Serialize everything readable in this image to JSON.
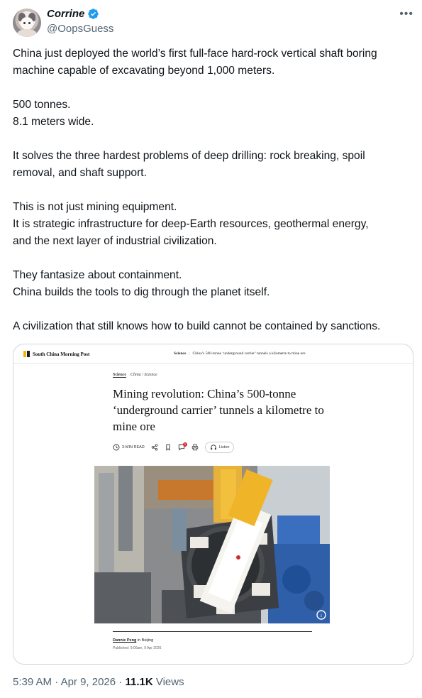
{
  "author": {
    "name": "Corrine",
    "handle": "@OopsGuess"
  },
  "tweet": {
    "paragraphs": [
      [
        "China just deployed the world’s first full-face hard-rock vertical shaft boring",
        "machine capable of excavating beyond 1,000 meters."
      ],
      [
        "500 tonnes.",
        "8.1 meters wide."
      ],
      [
        "It solves the three hardest problems of deep drilling: rock breaking, spoil",
        "removal, and shaft support."
      ],
      [
        "This is not just mining equipment.",
        "It is strategic infrastructure for deep-Earth resources, geothermal energy,",
        "and the next layer of industrial civilization."
      ],
      [
        "They fantasize about containment.",
        "China builds the tools to dig through the planet itself."
      ],
      [
        "A civilization that still knows how to build cannot be contained by sanctions."
      ]
    ]
  },
  "card": {
    "publication": "South China Morning Post",
    "crumb_section": "Science",
    "crumb_title": "China’s 500-tonne ‘underground carrier’ tunnels a kilometre to mine ore",
    "tag_main": "Science",
    "tag_sub": "China / Science",
    "headline": "Mining revolution: China’s 500-tonne ‘underground carrier’ tunnels a kilometre to mine ore",
    "read_time": "3-MIN READ",
    "comment_count": "3",
    "listen_label": "Listen",
    "author": "Dannie Peng",
    "location": "in Beijing",
    "published": "Published: 9:00am, 9 Apr 2026"
  },
  "meta": {
    "time": "5:39 AM",
    "date": "Apr 9, 2026",
    "views_count": "11.1K",
    "views_label": "Views",
    "separator": "·"
  },
  "colors": {
    "verified": "#1d9bf0",
    "secondary_text": "#536471",
    "card_border": "#cfd9de",
    "scmp_yellow": "#f2b705"
  },
  "icons": [
    "verified-badge-icon",
    "more-icon",
    "clock-icon",
    "share-icon",
    "bookmark-icon",
    "comment-icon",
    "print-icon",
    "headphones-icon",
    "info-icon"
  ]
}
